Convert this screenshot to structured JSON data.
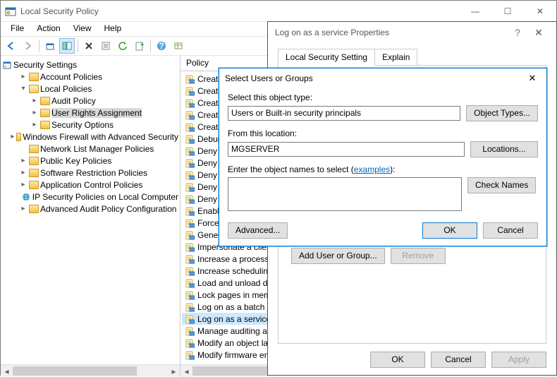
{
  "window": {
    "title": "Local Security Policy"
  },
  "menubar": [
    "File",
    "Action",
    "View",
    "Help"
  ],
  "tree": {
    "root": "Security Settings",
    "items": [
      {
        "label": "Account Policies",
        "depth": 1,
        "expand": "▸"
      },
      {
        "label": "Local Policies",
        "depth": 1,
        "expand": "▾",
        "open": true
      },
      {
        "label": "Audit Policy",
        "depth": 2,
        "expand": "▸"
      },
      {
        "label": "User Rights Assignment",
        "depth": 2,
        "expand": "▸",
        "selected": true
      },
      {
        "label": "Security Options",
        "depth": 2,
        "expand": "▸"
      },
      {
        "label": "Windows Firewall with Advanced Security",
        "depth": 1,
        "expand": "▸"
      },
      {
        "label": "Network List Manager Policies",
        "depth": 1,
        "expand": ""
      },
      {
        "label": "Public Key Policies",
        "depth": 1,
        "expand": "▸"
      },
      {
        "label": "Software Restriction Policies",
        "depth": 1,
        "expand": "▸"
      },
      {
        "label": "Application Control Policies",
        "depth": 1,
        "expand": "▸"
      },
      {
        "label": "IP Security Policies on Local Computer",
        "depth": 1,
        "expand": "",
        "special": true
      },
      {
        "label": "Advanced Audit Policy Configuration",
        "depth": 1,
        "expand": "▸"
      }
    ]
  },
  "policies": {
    "header": "Policy",
    "items": [
      "Create a pagefile",
      "Create a token object",
      "Create global objects",
      "Create permanent shared objects",
      "Create symbolic links",
      "Debug programs",
      "Deny access to this computer from the network",
      "Deny log on as a batch job",
      "Deny log on as a service",
      "Deny log on locally",
      "Deny log on through Remote Desktop Services",
      "Enable computer and user accounts to be trusted for delegation",
      "Force shutdown from a remote system",
      "Generate security audits",
      "Impersonate a client after authentication",
      "Increase a process working set",
      "Increase scheduling priority",
      "Load and unload device drivers",
      "Lock pages in memory",
      "Log on as a batch job",
      "Log on as a service",
      "Manage auditing and security log",
      "Modify an object label",
      "Modify firmware environment values"
    ],
    "selected_index": 20
  },
  "props": {
    "title": "Log on as a service Properties",
    "tabs": [
      "Local Security Setting",
      "Explain"
    ],
    "add_btn": "Add User or Group...",
    "remove_btn": "Remove",
    "ok": "OK",
    "cancel": "Cancel",
    "apply": "Apply"
  },
  "select": {
    "title": "Select Users or Groups",
    "object_type_label": "Select this object type:",
    "object_type_value": "Users or Built-in security principals",
    "object_types_btn": "Object Types...",
    "from_location_label": "From this location:",
    "from_location_value": "MGSERVER",
    "locations_btn": "Locations...",
    "names_label_1": "Enter the object names to select (",
    "names_label_link": "examples",
    "names_label_2": "):",
    "check_names_btn": "Check Names",
    "advanced_btn": "Advanced...",
    "ok": "OK",
    "cancel": "Cancel"
  }
}
